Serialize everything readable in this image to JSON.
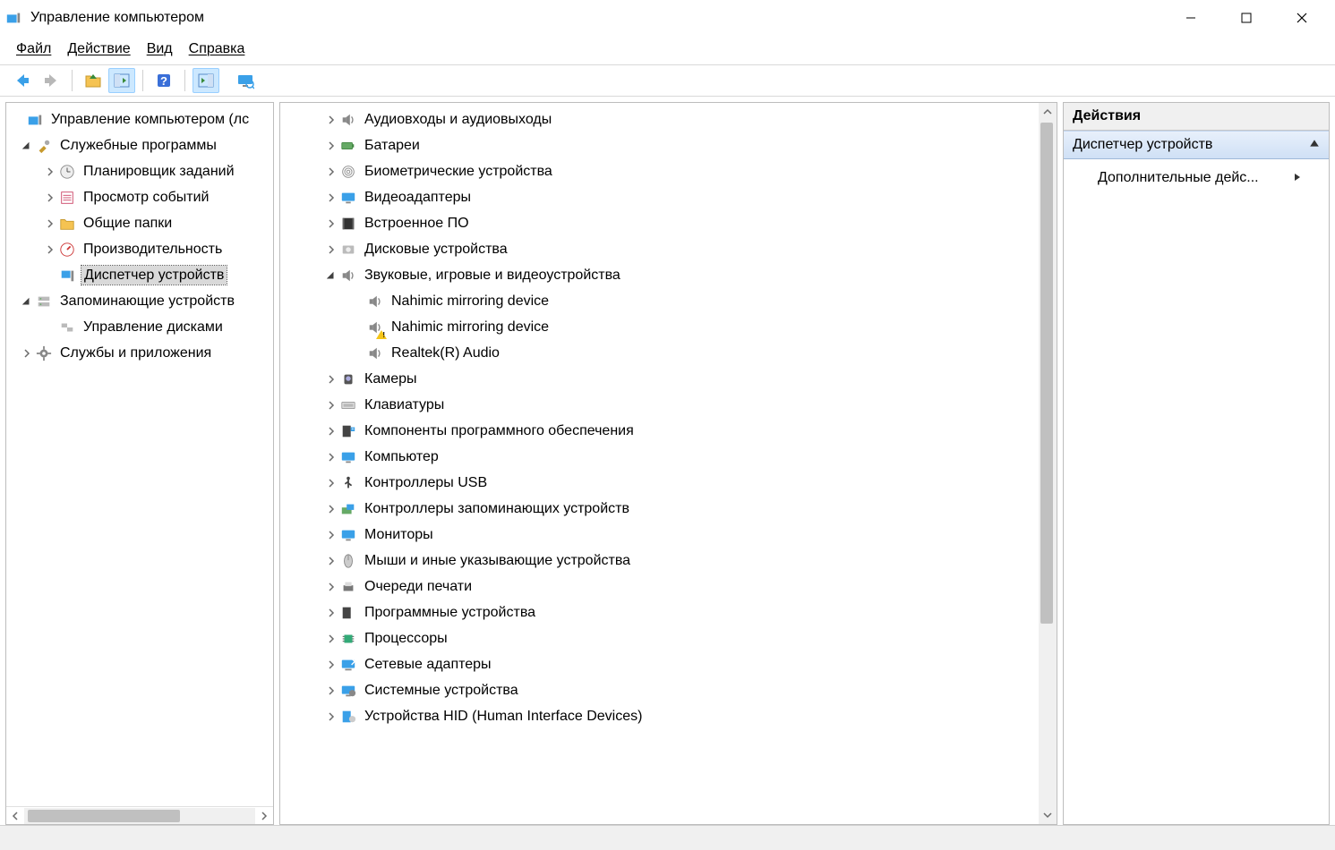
{
  "window": {
    "title": "Управление компьютером"
  },
  "menu": {
    "file": "Файл",
    "action": "Действие",
    "view": "Вид",
    "help": "Справка"
  },
  "left_tree": {
    "root": "Управление компьютером (лс",
    "system_tools": "Служебные программы",
    "task_scheduler": "Планировщик заданий",
    "event_viewer": "Просмотр событий",
    "shared_folders": "Общие папки",
    "performance": "Производительность",
    "device_manager": "Диспетчер устройств",
    "storage": "Запоминающие устройств",
    "disk_mgmt": "Управление дисками",
    "services_apps": "Службы и приложения"
  },
  "center_tree": {
    "audio_io": "Аудиовходы и аудиовыходы",
    "batteries": "Батареи",
    "biometric": "Биометрические устройства",
    "video_adapters": "Видеоадаптеры",
    "firmware": "Встроенное ПО",
    "disk_drives": "Дисковые устройства",
    "sound_video_game": "Звуковые, игровые и видеоустройства",
    "nahimic1": "Nahimic mirroring device",
    "nahimic2": "Nahimic mirroring device",
    "realtek": "Realtek(R) Audio",
    "cameras": "Камеры",
    "keyboards": "Клавиатуры",
    "software_components": "Компоненты программного обеспечения",
    "computer": "Компьютер",
    "usb_controllers": "Контроллеры USB",
    "storage_controllers": "Контроллеры запоминающих устройств",
    "monitors": "Мониторы",
    "mice": "Мыши и иные указывающие устройства",
    "print_queues": "Очереди печати",
    "software_devices": "Программные устройства",
    "processors": "Процессоры",
    "network_adapters": "Сетевые адаптеры",
    "system_devices": "Системные устройства",
    "hid": "Устройства HID (Human Interface Devices)"
  },
  "actions": {
    "header": "Действия",
    "title": "Диспетчер устройств",
    "more": "Дополнительные дейс..."
  }
}
